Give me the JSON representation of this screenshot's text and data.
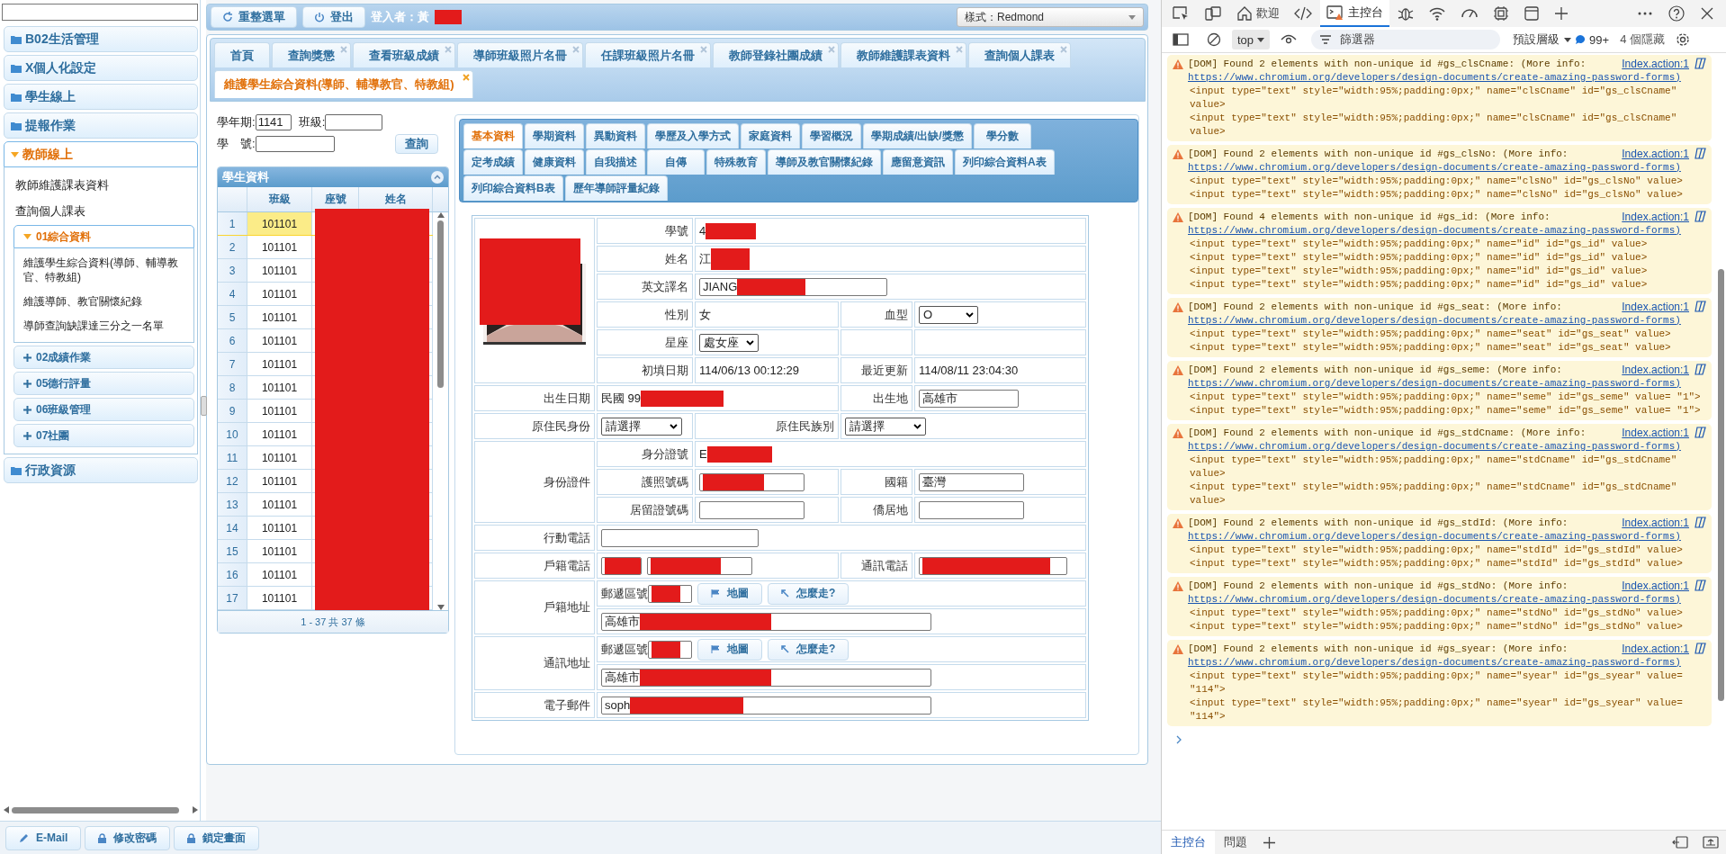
{
  "sidebar": {
    "sections": [
      {
        "label": "B02生活管理",
        "expanded": false
      },
      {
        "label": "X個人化設定",
        "expanded": false
      },
      {
        "label": "學生線上",
        "expanded": false
      },
      {
        "label": "提報作業",
        "expanded": false
      },
      {
        "label": "教師線上",
        "expanded": true,
        "items": [
          {
            "kind": "link",
            "label": "教師維護課表資料"
          },
          {
            "kind": "link",
            "label": "查詢個人課表"
          },
          {
            "kind": "group",
            "label": "01綜合資料",
            "expanded": true,
            "children": [
              {
                "label": "維護學生綜合資料(導師、輔導教官、特教組)"
              },
              {
                "label": "維護導師、教官關懷紀錄"
              },
              {
                "label": "導師查詢缺課達三分之一名單"
              }
            ]
          },
          {
            "kind": "group",
            "label": "02成績作業",
            "expanded": false
          },
          {
            "kind": "group",
            "label": "05德行評量",
            "expanded": false
          },
          {
            "kind": "group",
            "label": "06班級管理",
            "expanded": false
          },
          {
            "kind": "group",
            "label": "07社團",
            "expanded": false
          }
        ]
      },
      {
        "label": "行政資源",
        "expanded": false
      }
    ]
  },
  "bottom_buttons": [
    {
      "label": "E-Mail",
      "kind": "mail"
    },
    {
      "label": "修改密碼",
      "kind": "lock"
    },
    {
      "label": "鎖定畫面",
      "kind": "lock"
    }
  ],
  "toolbar": {
    "buttons": [
      {
        "label": "重整選單",
        "kind": "refresh"
      },
      {
        "label": "登出",
        "kind": "power"
      }
    ],
    "user": "登入者：黃",
    "user_redacted": true,
    "theme": "樣式：Redmond"
  },
  "tabs": [
    {
      "label": "首頁",
      "selected": false,
      "closable": false
    },
    {
      "label": "查詢獎懲",
      "selected": false,
      "closable": true
    },
    {
      "label": "查看班級成績",
      "selected": false,
      "closable": true
    },
    {
      "label": "導師班級照片名冊",
      "selected": false,
      "closable": true
    },
    {
      "label": "任課班級照片名冊",
      "selected": false,
      "closable": true
    },
    {
      "label": "教師登錄社團成績",
      "selected": false,
      "closable": true
    },
    {
      "label": "教師維護課表資料",
      "selected": false,
      "closable": true
    },
    {
      "label": "查詢個人課表",
      "selected": false,
      "closable": true
    },
    {
      "label": "維護學生綜合資料(導師、輔導教官、特教組)",
      "selected": true,
      "closable": true
    }
  ],
  "query": {
    "term_label": "學年期:",
    "term_value": "1141",
    "class_label": "班級:",
    "id_label": "學　號:",
    "button": "查詢"
  },
  "grid": {
    "title": "學生資料",
    "columns": [
      "班級",
      "座號",
      "姓名"
    ],
    "redacted": true,
    "rows": [
      {
        "no": "1",
        "class": "101101",
        "selected": true
      },
      {
        "no": "2",
        "class": "101101",
        "selected": false
      },
      {
        "no": "3",
        "class": "101101",
        "selected": false
      },
      {
        "no": "4",
        "class": "101101",
        "selected": false
      },
      {
        "no": "5",
        "class": "101101",
        "selected": false
      },
      {
        "no": "6",
        "class": "101101",
        "selected": false
      },
      {
        "no": "7",
        "class": "101101",
        "selected": false
      },
      {
        "no": "8",
        "class": "101101",
        "selected": false
      },
      {
        "no": "9",
        "class": "101101",
        "selected": false
      },
      {
        "no": "10",
        "class": "101101",
        "selected": false
      },
      {
        "no": "11",
        "class": "101101",
        "selected": false
      },
      {
        "no": "12",
        "class": "101101",
        "selected": false
      },
      {
        "no": "13",
        "class": "101101",
        "selected": false
      },
      {
        "no": "14",
        "class": "101101",
        "selected": false
      },
      {
        "no": "15",
        "class": "101101",
        "selected": false
      },
      {
        "no": "16",
        "class": "101101",
        "selected": false
      },
      {
        "no": "17",
        "class": "101101",
        "selected": false
      }
    ],
    "footer": "1 - 37 共 37 條"
  },
  "detail_tabs": [
    [
      {
        "label": "基本資料",
        "selected": true
      },
      {
        "label": "學期資料",
        "selected": false
      },
      {
        "label": "異動資料",
        "selected": false
      },
      {
        "label": "學歷及入學方式",
        "selected": false
      },
      {
        "label": "家庭資料",
        "selected": false
      },
      {
        "label": "學習概況",
        "selected": false
      },
      {
        "label": "學期成績/出缺/獎懲",
        "selected": false
      },
      {
        "label": "學分數",
        "selected": false
      }
    ],
    [
      {
        "label": "定考成績",
        "selected": false
      },
      {
        "label": "健康資料",
        "selected": false
      },
      {
        "label": "自我描述",
        "selected": false
      },
      {
        "label": "自傳",
        "selected": false
      },
      {
        "label": "特殊教育",
        "selected": false
      },
      {
        "label": "導師及教官關懷紀錄",
        "selected": false
      },
      {
        "label": "應留意資訊",
        "selected": false
      },
      {
        "label": "列印綜合資料A表",
        "selected": false
      }
    ],
    [
      {
        "label": "列印綜合資料B表",
        "selected": false
      },
      {
        "label": "歷年導師評量紀錄",
        "selected": false
      }
    ]
  ],
  "form": {
    "photo": {
      "kind": "picture",
      "redacted": true
    },
    "student_no": {
      "label": "學號",
      "value": "4",
      "redacted": true
    },
    "name": {
      "label": "姓名",
      "value": "江",
      "redacted": true
    },
    "english_name": {
      "label": "英文譯名",
      "value": "JIANG",
      "redacted": true
    },
    "gender": {
      "label": "性別",
      "value": "女"
    },
    "blood_type": {
      "label": "血型",
      "value": "O"
    },
    "zodiac": {
      "label": "星座",
      "value": "處女座"
    },
    "created": {
      "label": "初填日期",
      "value": "114/06/13 00:12:29"
    },
    "updated": {
      "label": "最近更新",
      "value": "114/08/11 23:04:30"
    },
    "birth_date": {
      "label": "出生日期",
      "value": "民國 99",
      "redacted": true
    },
    "birth_place": {
      "label": "出生地",
      "value": "高雄市"
    },
    "indigenous_status": {
      "label": "原住民身份",
      "value": "請選擇"
    },
    "indigenous_tribe": {
      "label": "原住民族別",
      "value": "請選擇"
    },
    "id_docs": "身份證件",
    "id_no": {
      "label": "身分證號",
      "value": "E",
      "redacted": true
    },
    "passport": {
      "label": "護照號碼",
      "redacted": true
    },
    "nationality": {
      "label": "國籍",
      "value": "臺灣"
    },
    "residence_permit": {
      "label": "居留證號碼"
    },
    "overseas": {
      "label": "僑居地"
    },
    "mobile": {
      "label": "行動電話"
    },
    "home_phone": {
      "label": "戶籍電話",
      "redacted": true
    },
    "contact_phone": {
      "label": "通訊電話",
      "redacted": true
    },
    "addresses": [
      {
        "label": "戶籍地址",
        "zip_label": "郵遞區號",
        "map_button": "地圖",
        "route_button": "怎麼走?",
        "value": "高雄市",
        "redacted": true
      },
      {
        "label": "通訊地址",
        "zip_label": "郵遞區號",
        "map_button": "地圖",
        "route_button": "怎麼走?",
        "value": "高雄市",
        "redacted": true
      }
    ],
    "email": {
      "label": "電子郵件",
      "value": "soph",
      "redacted": true
    }
  },
  "devtools": {
    "tabs": [
      {
        "kind": "inspect",
        "selected": false
      },
      {
        "kind": "device",
        "selected": false
      },
      {
        "kind": "welcome",
        "label": "歡迎",
        "selected": false
      },
      {
        "kind": "sources",
        "selected": false
      },
      {
        "kind": "console",
        "label": "主控台",
        "selected": true
      },
      {
        "kind": "debug",
        "selected": false
      },
      {
        "kind": "network",
        "selected": false
      },
      {
        "kind": "performance",
        "selected": false
      },
      {
        "kind": "memory",
        "selected": false
      },
      {
        "kind": "application",
        "selected": false
      },
      {
        "kind": "add",
        "selected": false
      }
    ],
    "context": "top",
    "filter_placeholder": "篩選器",
    "level": "預設層級",
    "message_count": "99+",
    "hidden": "4 個隱藏",
    "messages": [
      {
        "text": "[DOM] Found 2 elements with non-unique id #gs_clsCname: (More info:",
        "url": "https://www.chromium.org/developers/design-documents/create-amazing-password-forms)",
        "source": "Index.action:1",
        "lines": [
          "<input type=\"text\" style=\"width:95%;padding:0px;\" name=\"clsCname\" id=\"gs_clsCname\" value>",
          "<input type=\"text\" style=\"width:95%;padding:0px;\" name=\"clsCname\" id=\"gs_clsCname\" value>"
        ]
      },
      {
        "text": "[DOM] Found 2 elements with non-unique id #gs_clsNo: (More info:",
        "url": "https://www.chromium.org/developers/design-documents/create-amazing-password-forms)",
        "source": "Index.action:1",
        "lines": [
          "<input type=\"text\" style=\"width:95%;padding:0px;\" name=\"clsNo\" id=\"gs_clsNo\" value>",
          "<input type=\"text\" style=\"width:95%;padding:0px;\" name=\"clsNo\" id=\"gs_clsNo\" value>"
        ]
      },
      {
        "text": "[DOM] Found 4 elements with non-unique id #gs_id: (More info:",
        "url": "https://www.chromium.org/developers/design-documents/create-amazing-password-forms)",
        "source": "Index.action:1",
        "lines": [
          "<input type=\"text\" style=\"width:95%;padding:0px;\" name=\"id\" id=\"gs_id\" value>",
          "<input type=\"text\" style=\"width:95%;padding:0px;\" name=\"id\" id=\"gs_id\" value>",
          "<input type=\"text\" style=\"width:95%;padding:0px;\" name=\"id\" id=\"gs_id\" value>",
          "<input type=\"text\" style=\"width:95%;padding:0px;\" name=\"id\" id=\"gs_id\" value>"
        ]
      },
      {
        "text": "[DOM] Found 2 elements with non-unique id #gs_seat: (More info:",
        "url": "https://www.chromium.org/developers/design-documents/create-amazing-password-forms)",
        "source": "Index.action:1",
        "lines": [
          "<input type=\"text\" style=\"width:95%;padding:0px;\" name=\"seat\" id=\"gs_seat\" value>",
          "<input type=\"text\" style=\"width:95%;padding:0px;\" name=\"seat\" id=\"gs_seat\" value>"
        ]
      },
      {
        "text": "[DOM] Found 2 elements with non-unique id #gs_seme: (More info:",
        "url": "https://www.chromium.org/developers/design-documents/create-amazing-password-forms)",
        "source": "Index.action:1",
        "lines": [
          "<input type=\"text\" style=\"width:95%;padding:0px;\" name=\"seme\" id=\"gs_seme\" value= \"1\">",
          "<input type=\"text\" style=\"width:95%;padding:0px;\" name=\"seme\" id=\"gs_seme\" value= \"1\">"
        ]
      },
      {
        "text": "[DOM] Found 2 elements with non-unique id #gs_stdCname: (More info:",
        "url": "https://www.chromium.org/developers/design-documents/create-amazing-password-forms)",
        "source": "Index.action:1",
        "lines": [
          "<input type=\"text\" style=\"width:95%;padding:0px;\" name=\"stdCname\" id=\"gs_stdCname\" value>",
          "<input type=\"text\" style=\"width:95%;padding:0px;\" name=\"stdCname\" id=\"gs_stdCname\" value>"
        ]
      },
      {
        "text": "[DOM] Found 2 elements with non-unique id #gs_stdId: (More info:",
        "url": "https://www.chromium.org/developers/design-documents/create-amazing-password-forms)",
        "source": "Index.action:1",
        "lines": [
          "<input type=\"text\" style=\"width:95%;padding:0px;\" name=\"stdId\" id=\"gs_stdId\" value>",
          "<input type=\"text\" style=\"width:95%;padding:0px;\" name=\"stdId\" id=\"gs_stdId\" value>"
        ]
      },
      {
        "text": "[DOM] Found 2 elements with non-unique id #gs_stdNo: (More info:",
        "url": "https://www.chromium.org/developers/design-documents/create-amazing-password-forms)",
        "source": "Index.action:1",
        "lines": [
          "<input type=\"text\" style=\"width:95%;padding:0px;\" name=\"stdNo\" id=\"gs_stdNo\" value>",
          "<input type=\"text\" style=\"width:95%;padding:0px;\" name=\"stdNo\" id=\"gs_stdNo\" value>"
        ]
      },
      {
        "text": "[DOM] Found 2 elements with non-unique id #gs_syear: (More info:",
        "url": "https://www.chromium.org/developers/design-documents/create-amazing-password-forms)",
        "source": "Index.action:1",
        "lines": [
          "<input type=\"text\" style=\"width:95%;padding:0px;\" name=\"syear\" id=\"gs_syear\" value= \"114\">",
          "<input type=\"text\" style=\"width:95%;padding:0px;\" name=\"syear\" id=\"gs_syear\" value= \"114\">"
        ]
      }
    ],
    "bottom_tabs": [
      {
        "label": "主控台",
        "selected": true
      },
      {
        "label": "問題",
        "selected": false
      }
    ]
  }
}
